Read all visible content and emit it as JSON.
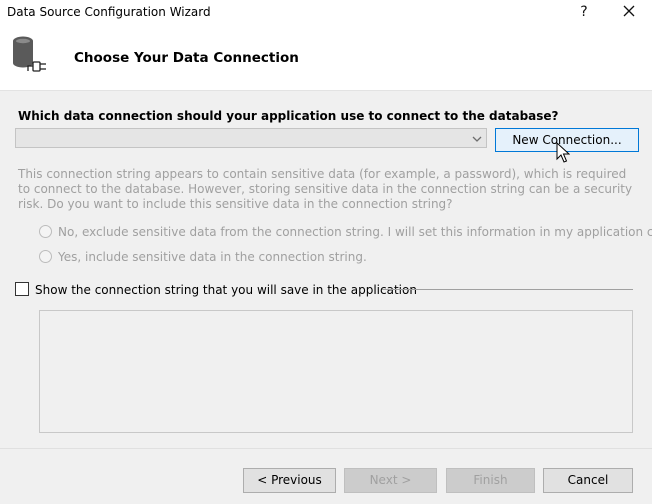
{
  "window": {
    "title": "Data Source Configuration Wizard",
    "help_label": "?",
    "close_label": "✕"
  },
  "header": {
    "icon": "database-connection-icon",
    "title": "Choose Your Data Connection"
  },
  "connection": {
    "question": "Which data connection should your application use to connect to the database?",
    "selected_value": "",
    "new_connection_label": "New Connection..."
  },
  "sensitive": {
    "message": "This connection string appears to contain sensitive data (for example, a password), which is required to connect to the database. However, storing sensitive data in the connection string can be a security risk. Do you want to include this sensitive data in the connection string?",
    "option_exclude": "No, exclude sensitive data from the connection string. I will set this information in my application code.",
    "option_include": "Yes, include sensitive data in the connection string."
  },
  "show_string": {
    "label": "Show the connection string that you will save in the application",
    "checked": false,
    "value": ""
  },
  "footer": {
    "previous_label": "< Previous",
    "next_label": "Next >",
    "finish_label": "Finish",
    "cancel_label": "Cancel"
  },
  "colors": {
    "accent": "#0078d7",
    "disabled_text": "#a0a0a0"
  }
}
